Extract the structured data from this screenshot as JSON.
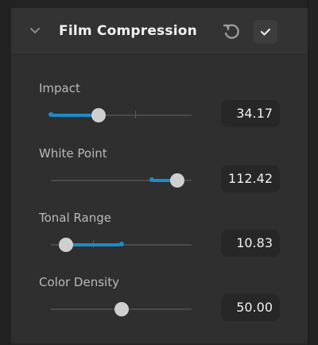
{
  "panel": {
    "title": "Film Compression",
    "icons": {
      "collapse": "chevron-down-icon",
      "reset": "reset-icon",
      "enable": "checkmark-icon"
    }
  },
  "params": [
    {
      "label": "Impact",
      "value": "34.17",
      "thumb_pct": 0.34,
      "fill_from_pct": 0.0,
      "fill_to_pct": 0.34,
      "tick_pct": 0.6
    },
    {
      "label": "White Point",
      "value": "112.42",
      "thumb_pct": 0.9,
      "fill_from_pct": 0.72,
      "fill_to_pct": 0.9,
      "tick_pct": null
    },
    {
      "label": "Tonal Range",
      "value": "10.83",
      "thumb_pct": 0.11,
      "fill_from_pct": 0.11,
      "fill_to_pct": 0.5,
      "tick_pct": 0.3
    },
    {
      "label": "Color Density",
      "value": "50.00",
      "thumb_pct": 0.5,
      "fill_from_pct": null,
      "fill_to_pct": null,
      "tick_pct": null
    }
  ],
  "colors": {
    "accent": "#1a8cc9",
    "thumb": "#cfcfcf",
    "panel_bg": "#2f2f2f"
  }
}
